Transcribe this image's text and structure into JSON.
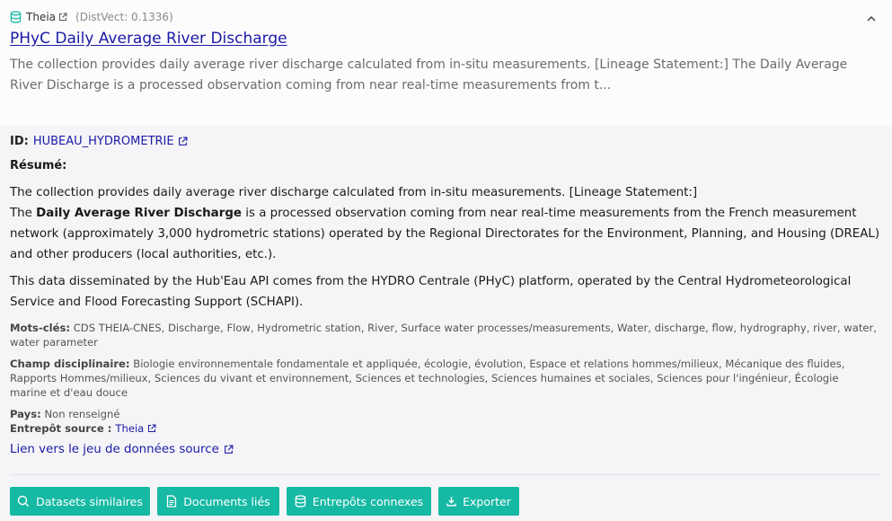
{
  "source": {
    "name": "Theia",
    "distvect": "(DistVect: 0.1336)"
  },
  "title": "PHyC Daily Average River Discharge",
  "summary": "The collection provides daily average river discharge calculated from in-situ measurements. [Lineage Statement:] The Daily Average River Discharge is a processed observation coming from near real-time measurements from t...",
  "id": {
    "label": "ID:",
    "value": "HUBEAU_HYDROMETRIE"
  },
  "resume_label": "Résumé:",
  "p1": {
    "line1": "The collection provides daily average river discharge calculated from in-situ measurements. [Lineage Statement:]",
    "pre": "The ",
    "bold": "Daily Average River Discharge",
    "post": " is a processed observation coming from near real-time measurements from the French measurement network (approximately 3,000 hydrometric stations) operated by the Regional Directorates for the Environment, Planning, and Housing (DREAL) and other producers (local authorities, etc.)."
  },
  "p2": "This data disseminated by the Hub'Eau API comes from the HYDRO Centrale (PHyC) platform, operated by the Central Hydrometeorological Service and Flood Forecasting Support (SCHAPI).",
  "meta": {
    "keywords_label": "Mots-clés:",
    "keywords": "CDS THEIA-CNES, Discharge, Flow, Hydrometric station, River, Surface water processes/measurements, Water, discharge, flow, hydrography, river, water, water parameter",
    "field_label": "Champ disciplinaire:",
    "field": "Biologie environnementale fondamentale et appliquée, écologie, évolution, Espace et relations hommes/milieux, Mécanique des fluides, Rapports Hommes/milieux, Sciences du vivant et environnement, Sciences et technologies, Sciences humaines et sociales, Sciences pour l'ingénieur, Écologie marine et d'eau douce",
    "country_label": "Pays:",
    "country": "Non renseigné",
    "repo_label": "Entrepôt source :",
    "repo": "Theia"
  },
  "source_link": "Lien vers le jeu de données source",
  "buttons": {
    "similar": "Datasets similaires",
    "docs": "Documents liés",
    "repos": "Entrepôts connexes",
    "export": "Exporter"
  },
  "colors": {
    "accent": "#16b9a4",
    "link": "#1a1aa6"
  },
  "icons": [
    "database-icon",
    "external-link-icon",
    "chevron-up-icon",
    "search-icon",
    "document-icon",
    "download-icon"
  ]
}
